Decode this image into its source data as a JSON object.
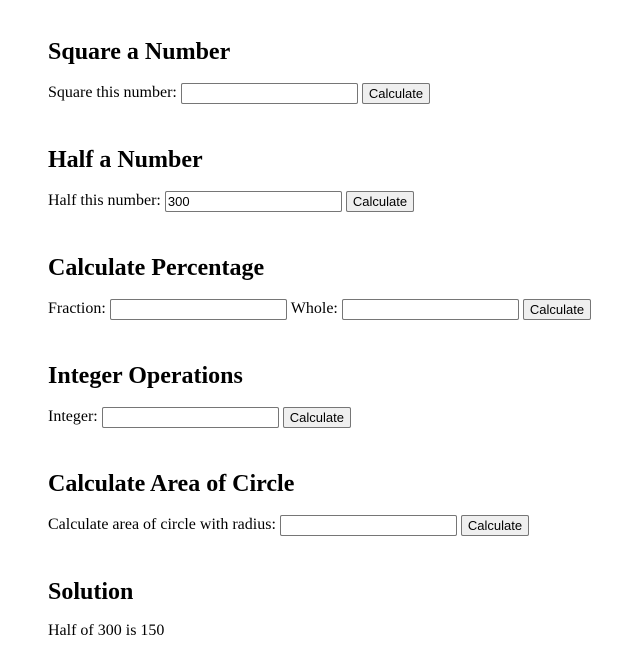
{
  "square": {
    "heading": "Square a Number",
    "label": "Square this number:",
    "input_value": "",
    "button_label": "Calculate"
  },
  "half": {
    "heading": "Half a Number",
    "label": "Half this number:",
    "input_value": "300",
    "button_label": "Calculate"
  },
  "percentage": {
    "heading": "Calculate Percentage",
    "fraction_label": "Fraction:",
    "fraction_value": "",
    "whole_label": "Whole:",
    "whole_value": "",
    "button_label": "Calculate"
  },
  "integer_ops": {
    "heading": "Integer Operations",
    "label": "Integer:",
    "input_value": "",
    "button_label": "Calculate"
  },
  "circle": {
    "heading": "Calculate Area of Circle",
    "label": "Calculate area of circle with radius:",
    "input_value": "",
    "button_label": "Calculate"
  },
  "solution": {
    "heading": "Solution",
    "text": "Half of 300 is 150"
  }
}
